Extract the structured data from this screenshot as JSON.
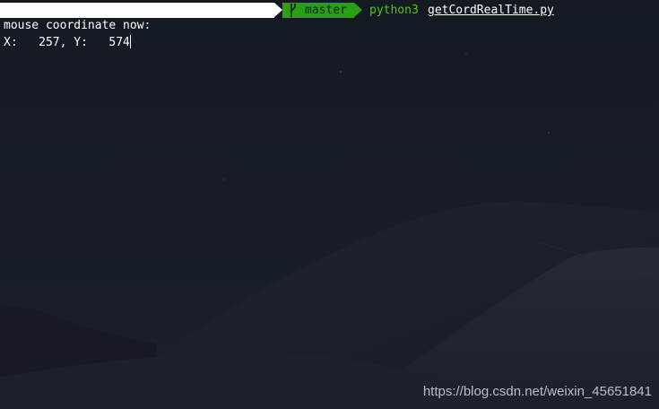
{
  "prompt": {
    "branch_icon": "git-branch-icon",
    "branch": "master",
    "command": "python3",
    "argument": "getCordRealTime.py"
  },
  "output": {
    "line1": "mouse coordinate now:",
    "line2": "X:   257, Y:   574"
  },
  "watermark": "https://blog.csdn.net/weixin_45651841",
  "colors": {
    "background": "#151a22",
    "git_segment": "#2a9f16",
    "command": "#52c41a",
    "text": "#ffffff"
  }
}
